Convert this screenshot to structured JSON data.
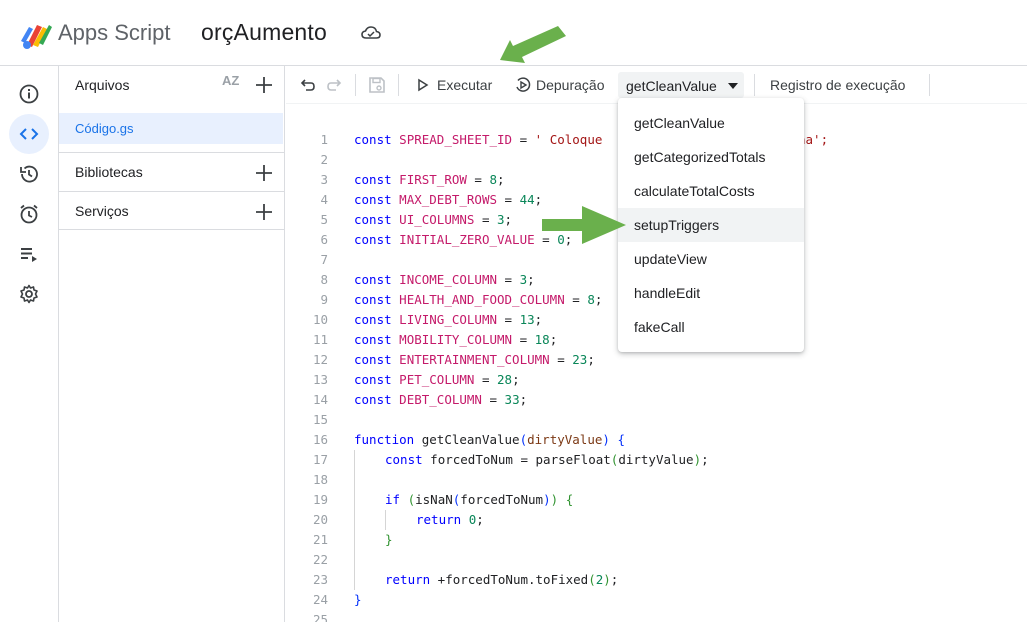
{
  "header": {
    "app_name": "Apps Script",
    "project_name": "orçAumento"
  },
  "files_panel": {
    "title": "Arquivos",
    "sort_label": "AZ",
    "files": [
      {
        "name": "Código.gs"
      }
    ],
    "sections": [
      {
        "label": "Bibliotecas"
      },
      {
        "label": "Serviços"
      }
    ]
  },
  "toolbar": {
    "run_label": "Executar",
    "debug_label": "Depuração",
    "selected_function": "getCleanValue",
    "log_label": "Registro de execução"
  },
  "function_menu": {
    "items": [
      {
        "label": "getCleanValue"
      },
      {
        "label": "getCategorizedTotals"
      },
      {
        "label": "calculateTotalCosts"
      },
      {
        "label": "setupTriggers"
      },
      {
        "label": "updateView"
      },
      {
        "label": "handleEdit"
      },
      {
        "label": "fakeCall"
      }
    ],
    "highlighted": "setupTriggers"
  },
  "code_lines": [
    {
      "n": "1",
      "text": "const SPREAD_SHEET_ID = ' Coloque"
    },
    {
      "n": "2",
      "text": ""
    },
    {
      "n": "3",
      "text": "const FIRST_ROW = 8;"
    },
    {
      "n": "4",
      "text": "const MAX_DEBT_ROWS = 44;"
    },
    {
      "n": "5",
      "text": "const UI_COLUMNS = 3;"
    },
    {
      "n": "6",
      "text": "const INITIAL_ZERO_VALUE = 0;"
    },
    {
      "n": "7",
      "text": ""
    },
    {
      "n": "8",
      "text": "const INCOME_COLUMN = 3;"
    },
    {
      "n": "9",
      "text": "const HEALTH_AND_FOOD_COLUMN = 8;"
    },
    {
      "n": "10",
      "text": "const LIVING_COLUMN = 13;"
    },
    {
      "n": "11",
      "text": "const MOBILITY_COLUMN = 18;"
    },
    {
      "n": "12",
      "text": "const ENTERTAINMENT_COLUMN = 23;"
    },
    {
      "n": "13",
      "text": "const PET_COLUMN = 28;"
    },
    {
      "n": "14",
      "text": "const DEBT_COLUMN = 33;"
    },
    {
      "n": "15",
      "text": ""
    },
    {
      "n": "16",
      "text": "function getCleanValue(dirtyValue) {"
    },
    {
      "n": "17",
      "text": "const forcedToNum = parseFloat(dirtyValue);"
    },
    {
      "n": "18",
      "text": ""
    },
    {
      "n": "19",
      "text": "if (isNaN(forcedToNum)) {"
    },
    {
      "n": "20",
      "text": "return 0;"
    },
    {
      "n": "21",
      "text": "}"
    },
    {
      "n": "22",
      "text": ""
    },
    {
      "n": "23",
      "text": "return +forcedToNum.toFixed(2);"
    },
    {
      "n": "24",
      "text": "}"
    },
    {
      "n": "25",
      "text": ""
    }
  ],
  "code_line1_tail": "na';",
  "colors": {
    "accent": "#1a73e8",
    "selection": "#e8f0fe",
    "arrow": "#6ab04c",
    "keyword": "#0000ff",
    "constant": "#c41a6a",
    "number": "#098658",
    "string": "#a31515"
  }
}
